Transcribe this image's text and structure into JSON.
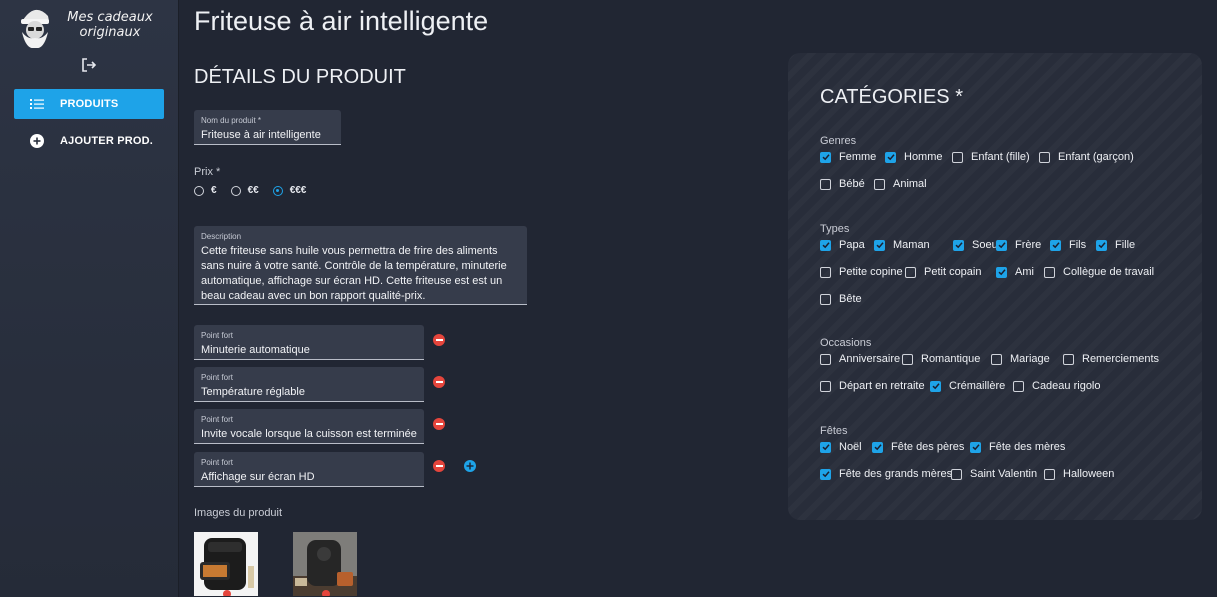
{
  "sidebar": {
    "logo_line1": "Mes cadeaux",
    "logo_line2": "originaux",
    "items": [
      {
        "label": "PRODUITS",
        "icon": "list-icon",
        "active": true
      },
      {
        "label": "AJOUTER PROD.",
        "icon": "add-circle-icon",
        "active": false
      }
    ]
  },
  "page": {
    "title": "Friteuse à air intelligente"
  },
  "details": {
    "section_title": "DÉTAILS DU PRODUIT",
    "name_label": "Nom du produit *",
    "name_value": "Friteuse à air intelligente",
    "price_label": "Prix *",
    "price_options": [
      "€",
      "€€",
      "€€€"
    ],
    "price_selected": "€€€",
    "description_label": "Description",
    "description_value": "Cette friteuse sans huile vous permettra de frire des aliments sans nuire à votre santé. Contrôle de la température, minuterie automatique, affichage sur écran HD. Cette friteuse est est un beau cadeau avec un bon rapport qualité-prix.",
    "highlight_label": "Point fort",
    "highlights": [
      "Minuterie automatique",
      "Température réglable",
      "Invite vocale lorsque la cuisson est terminée",
      "Affichage sur écran HD"
    ],
    "images_label": "Images du produit"
  },
  "categories": {
    "title": "CATÉGORIES *",
    "groups": [
      {
        "label": "Genres",
        "items": [
          {
            "label": "Femme",
            "checked": true
          },
          {
            "label": "Homme",
            "checked": true
          },
          {
            "label": "Enfant (fille)",
            "checked": false
          },
          {
            "label": "Enfant (garçon)",
            "checked": false
          },
          {
            "label": "Bébé",
            "checked": false
          },
          {
            "label": "Animal",
            "checked": false
          }
        ]
      },
      {
        "label": "Types",
        "items": [
          {
            "label": "Papa",
            "checked": true
          },
          {
            "label": "Maman",
            "checked": true
          },
          {
            "label": "Soeur",
            "checked": true
          },
          {
            "label": "Frère",
            "checked": true
          },
          {
            "label": "Fils",
            "checked": true
          },
          {
            "label": "Fille",
            "checked": true
          },
          {
            "label": "Petite copine",
            "checked": false
          },
          {
            "label": "Petit copain",
            "checked": false
          },
          {
            "label": "Ami",
            "checked": true
          },
          {
            "label": "Collègue de travail",
            "checked": false
          },
          {
            "label": "Bête",
            "checked": false
          }
        ]
      },
      {
        "label": "Occasions",
        "items": [
          {
            "label": "Anniversaire",
            "checked": false
          },
          {
            "label": "Romantique",
            "checked": false
          },
          {
            "label": "Mariage",
            "checked": false
          },
          {
            "label": "Remerciements",
            "checked": false
          },
          {
            "label": "Départ en retraite",
            "checked": false
          },
          {
            "label": "Crémaillère",
            "checked": true
          },
          {
            "label": "Cadeau rigolo",
            "checked": false
          }
        ]
      },
      {
        "label": "Fêtes",
        "items": [
          {
            "label": "Noël",
            "checked": true
          },
          {
            "label": "Fête des pères",
            "checked": true
          },
          {
            "label": "Fête des mères",
            "checked": true
          },
          {
            "label": "Fête des grands mères",
            "checked": true
          },
          {
            "label": "Saint Valentin",
            "checked": false
          },
          {
            "label": "Halloween",
            "checked": false
          }
        ]
      }
    ]
  },
  "colors": {
    "accent": "#1ea3e8",
    "danger": "#e5453c",
    "background": "#212633"
  }
}
